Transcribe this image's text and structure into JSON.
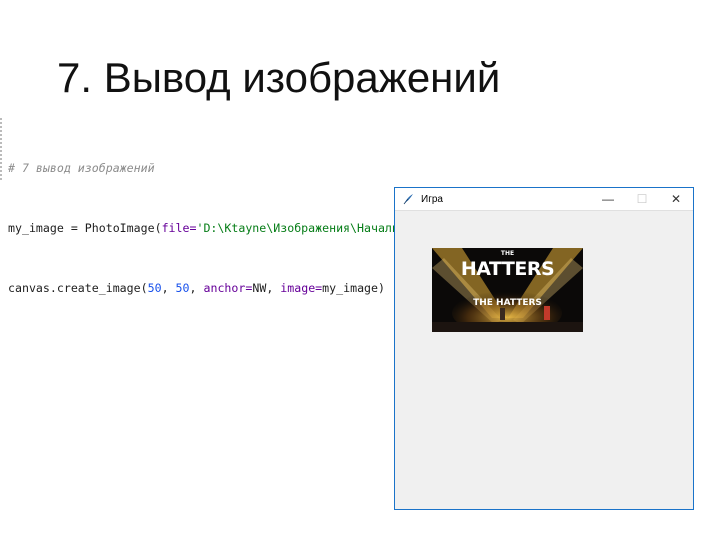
{
  "slide": {
    "title": "7. Вывод изображений"
  },
  "code": {
    "comment": "# 7 вывод изображений",
    "line2_var": "my_image = PhotoImage(",
    "line2_kw": "file=",
    "line2_str": "'D:\\Ktayne\\Изображения\\Начальное программирование\\The Hatters.png'",
    "line2_end": ")",
    "line3_a": "canvas.create_image(",
    "line3_n1": "50",
    "line3_sep": ", ",
    "line3_n2": "50",
    "line3_b": ", ",
    "line3_kw1": "anchor=",
    "line3_c": "NW, ",
    "line3_kw2": "image=",
    "line3_d": "my_image)"
  },
  "window": {
    "title": "Игра",
    "minimize_glyph": "—",
    "maximize_glyph": "☐",
    "close_glyph": "✕",
    "feather_icon": "tk-feather-icon"
  },
  "picture": {
    "small_top": "THE",
    "big": "HATTERS",
    "stage": "THE HATTERS"
  },
  "colors": {
    "title_bar_border": "#1a73c9",
    "window_bg": "#f0f0f0",
    "string": "#067d17",
    "number": "#1750eb",
    "keyword": "#660099",
    "comment": "#8c8c8c"
  }
}
